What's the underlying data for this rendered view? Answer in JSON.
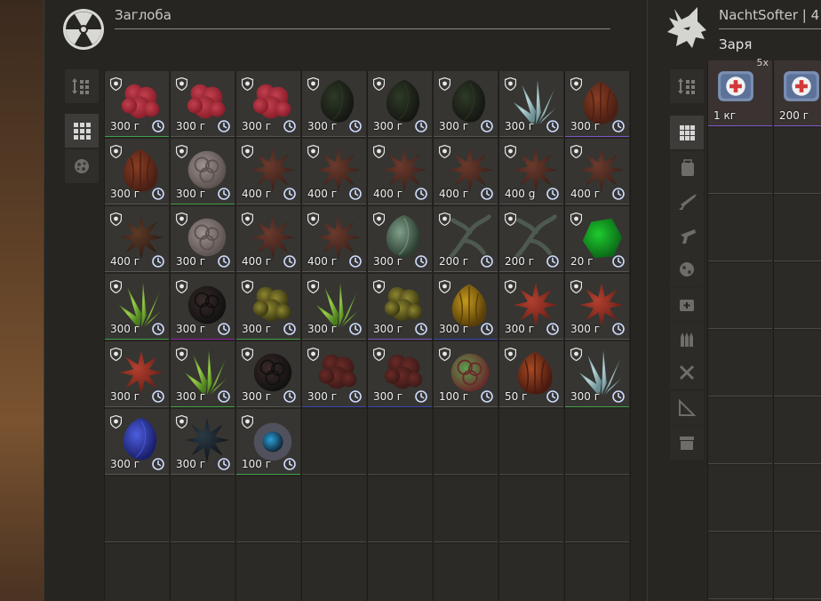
{
  "left_panel": {
    "title": "Заглоба",
    "logo_icon": "radiation-icon",
    "tabs": [
      {
        "icon": "sort-icon",
        "active": false
      },
      {
        "icon": "grid-all-icon",
        "active": true
      },
      {
        "icon": "artifact-icon",
        "active": false
      }
    ],
    "items": [
      {
        "weight": "300 г",
        "art": "red-coral",
        "quality": "#43a047"
      },
      {
        "weight": "300 г",
        "art": "red-coral",
        "quality": "#555"
      },
      {
        "weight": "300 г",
        "art": "red-coral",
        "quality": "#555"
      },
      {
        "weight": "300 г",
        "art": "black-shell",
        "quality": "#555"
      },
      {
        "weight": "300 г",
        "art": "black-shell",
        "quality": "#555"
      },
      {
        "weight": "300 г",
        "art": "black-shell",
        "quality": "#555"
      },
      {
        "weight": "300 г",
        "art": "ice-crystal",
        "quality": "#555"
      },
      {
        "weight": "300 г",
        "art": "brown-bulb",
        "quality": "#7e57c2"
      },
      {
        "weight": "300 г",
        "art": "brown-bulb",
        "quality": "#555"
      },
      {
        "weight": "300 г",
        "art": "grey-rose",
        "quality": "#43a047"
      },
      {
        "weight": "400 г",
        "art": "brown-star",
        "quality": "#555"
      },
      {
        "weight": "400 г",
        "art": "brown-star",
        "quality": "#555"
      },
      {
        "weight": "400 г",
        "art": "brown-star",
        "quality": "#555"
      },
      {
        "weight": "400 г",
        "art": "brown-star",
        "quality": "#555"
      },
      {
        "weight": "400 g",
        "art": "brown-star",
        "quality": "#555"
      },
      {
        "weight": "400 г",
        "art": "brown-star",
        "quality": "#555"
      },
      {
        "weight": "400 г",
        "art": "urchin",
        "quality": "#555"
      },
      {
        "weight": "300 г",
        "art": "grey-rose",
        "quality": "#555"
      },
      {
        "weight": "400 г",
        "art": "brown-star",
        "quality": "#555"
      },
      {
        "weight": "400 г",
        "art": "brown-star",
        "quality": "#555"
      },
      {
        "weight": "300 г",
        "art": "green-shard",
        "quality": "#555"
      },
      {
        "weight": "200 г",
        "art": "dark-branch",
        "quality": "#555"
      },
      {
        "weight": "200 г",
        "art": "dark-branch",
        "quality": "#555"
      },
      {
        "weight": "20 г",
        "art": "green-gem",
        "quality": "#555"
      },
      {
        "weight": "300 г",
        "art": "green-spikes",
        "quality": "#43a047"
      },
      {
        "weight": "300 г",
        "art": "coal",
        "quality": "#8e24aa"
      },
      {
        "weight": "300 г",
        "art": "gold-moss",
        "quality": "#43a047"
      },
      {
        "weight": "300 г",
        "art": "green-spikes",
        "quality": "#555"
      },
      {
        "weight": "300 г",
        "art": "gold-moss",
        "quality": "#7e57c2"
      },
      {
        "weight": "300 г",
        "art": "amber",
        "quality": "#3949ab"
      },
      {
        "weight": "300 г",
        "art": "red-star",
        "quality": "#555"
      },
      {
        "weight": "300 г",
        "art": "red-star",
        "quality": "#555"
      },
      {
        "weight": "300 г",
        "art": "red-star",
        "quality": "#555"
      },
      {
        "weight": "300 г",
        "art": "green-spikes",
        "quality": "#43a047"
      },
      {
        "weight": "300 г",
        "art": "coal",
        "quality": "#555"
      },
      {
        "weight": "300 г",
        "art": "red-blob",
        "quality": "#3949ab"
      },
      {
        "weight": "300 г",
        "art": "red-blob",
        "quality": "#3949ab"
      },
      {
        "weight": "100 г",
        "art": "flower-ball",
        "quality": "#555"
      },
      {
        "weight": "50 г",
        "art": "shell-orange",
        "quality": "#555"
      },
      {
        "weight": "300 г",
        "art": "ice-crystal",
        "quality": "#43a047"
      },
      {
        "weight": "300 г",
        "art": "blue-feather",
        "quality": "#555"
      },
      {
        "weight": "300 г",
        "art": "dark-urchin",
        "quality": "#555"
      },
      {
        "weight": "100 г",
        "art": "blue-orb",
        "quality": "#43a047"
      }
    ],
    "columns": 8,
    "rows": 8
  },
  "right_panel": {
    "title": "NachtSofter | 4",
    "subtitle": "Заря",
    "logo_icon": "wolf-icon",
    "tabs": [
      {
        "icon": "sort-icon",
        "active": false
      },
      {
        "icon": "grid-all-icon",
        "active": true
      },
      {
        "icon": "backpack-icon",
        "active": false
      },
      {
        "icon": "rifle-icon",
        "active": false
      },
      {
        "icon": "pistol-icon",
        "active": false
      },
      {
        "icon": "artifact-icon",
        "active": false
      },
      {
        "icon": "medkit-icon",
        "active": false
      },
      {
        "icon": "ammo-icon",
        "active": false
      },
      {
        "icon": "tools-icon",
        "active": false
      },
      {
        "icon": "misc-icon",
        "active": false
      },
      {
        "icon": "archive-icon",
        "active": false
      }
    ],
    "items": [
      {
        "weight": "1 кг",
        "count": "5x",
        "art": "medkit"
      },
      {
        "weight": "200 г",
        "count": "",
        "art": "medkit"
      }
    ]
  }
}
